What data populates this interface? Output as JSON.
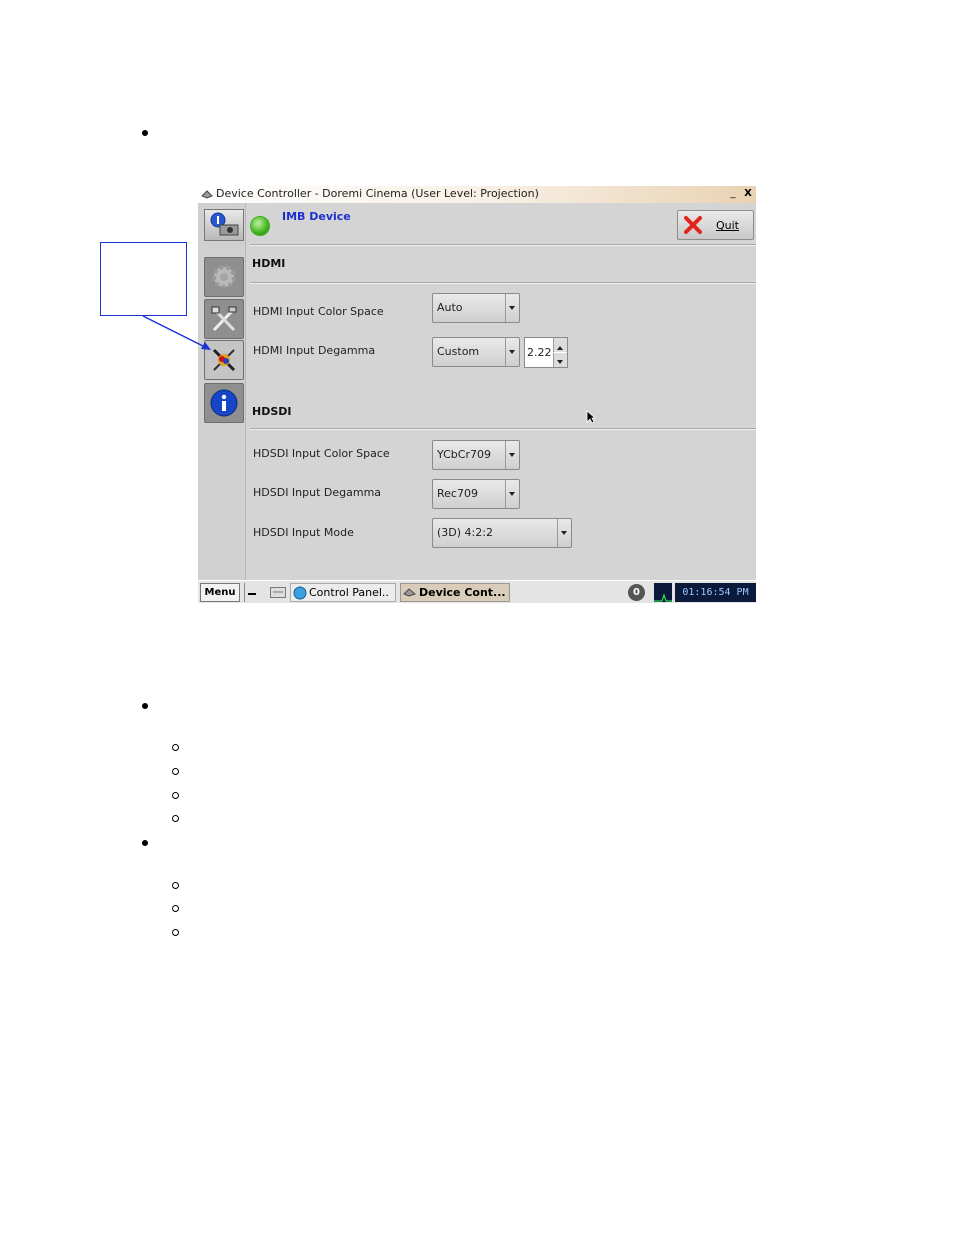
{
  "window": {
    "title": "Device Controller - Doremi Cinema (User Level: Projection)",
    "minimize_glyph": "_",
    "close_glyph": "X"
  },
  "header": {
    "device_name": "IMB Device",
    "status_color": "#3fb01f",
    "quit_label": "Quit"
  },
  "sidebar": {
    "items": [
      {
        "name": "settings-gear-icon"
      },
      {
        "name": "tools-icon"
      },
      {
        "name": "color-calibration-icon"
      },
      {
        "name": "info-icon"
      }
    ]
  },
  "hdmi": {
    "title": "HDMI",
    "color_space_label": "HDMI Input Color Space",
    "color_space_value": "Auto",
    "degamma_label": "HDMI Input Degamma",
    "degamma_value": "Custom",
    "degamma_custom_value": "2.22"
  },
  "hdsdi": {
    "title": "HDSDI",
    "color_space_label": "HDSDI Input Color Space",
    "color_space_value": "YCbCr709",
    "degamma_label": "HDSDI Input Degamma",
    "degamma_value": "Rec709",
    "mode_label": "HDSDI Input Mode",
    "mode_value": "(3D) 4:2:2"
  },
  "taskbar": {
    "menu_label": "Menu",
    "task_control_panel": "Control Panel..",
    "task_device_controller": "Device Cont...",
    "notification_count": "0",
    "clock": "01:16:54 PM"
  },
  "colors": {
    "accent_blue": "#1b33d6",
    "window_bg": "#d4d4d4"
  }
}
